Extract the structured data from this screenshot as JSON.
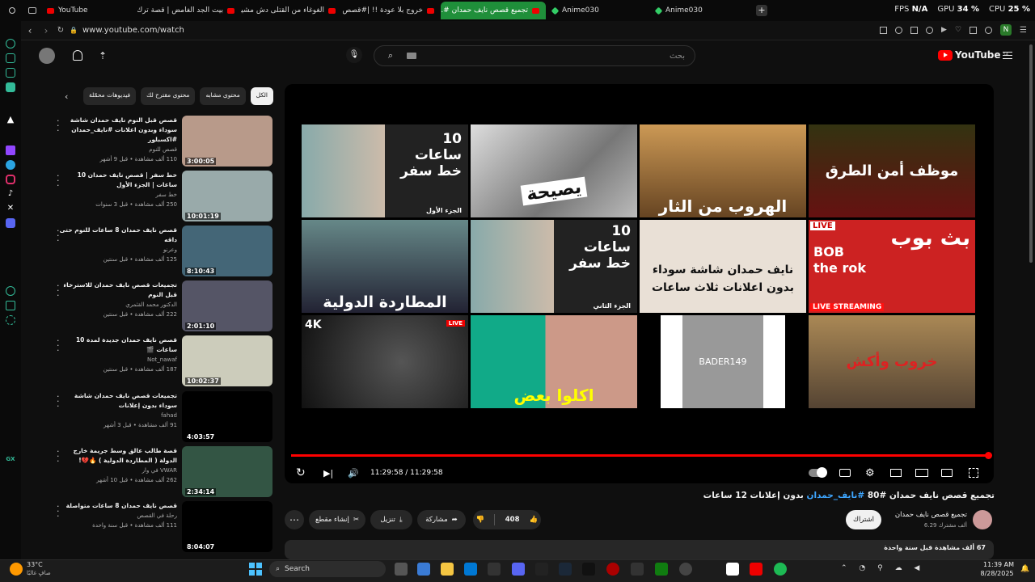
{
  "browser": {
    "tabs": [
      {
        "label": "YouTube",
        "icon": "youtube-icon"
      },
      {
        "label": "بيت الجد الغامض | قصة ترك...",
        "icon": "youtube-icon"
      },
      {
        "label": "الغوغاء من القتلى دش مشير",
        "icon": "youtube-icon"
      },
      {
        "label": "خروج بلا عودة !! |#قصص...",
        "icon": "youtube-icon"
      },
      {
        "label": "تجميع قصص نايف حمدان #...",
        "icon": "youtube-icon",
        "active": true
      },
      {
        "label": "Anime030",
        "icon": "gem-icon"
      },
      {
        "label": "Anime030",
        "icon": "gem-icon"
      }
    ],
    "new_tab": "+",
    "fps_label": "FPS",
    "fps_value": "N/A",
    "gpu_label": "GPU",
    "gpu_value": "34 %",
    "cpu_label": "CPU",
    "cpu_value": "25 %",
    "url": "www.youtube.com/watch",
    "profile_initial": "N"
  },
  "youtube": {
    "logo": "YouTube",
    "logo_region": "SA",
    "search_placeholder": "بحث"
  },
  "chips": [
    "الكل",
    "محتوى مشابه",
    "محتوى مقترح لك",
    "فيديوهات محمّلة"
  ],
  "related": [
    {
      "title": "قصص قبل النوم نايف حمدان شاشة سوداء وبدون اعلانات #نايف_حمدان #اكسبلور",
      "channel": "قصص للنوم",
      "meta": "110 ألف مشاهدة • قبل 9 أشهر",
      "duration": "3:00:05"
    },
    {
      "title": "خط سفر | قصص نايف حمدان 10 ساعات | الجزء الأول",
      "channel": "خط سفر",
      "meta": "250 ألف مشاهدة • قبل 3 سنوات",
      "duration": "10:01:19"
    },
    {
      "title": "قصص نايف حمدان 8 ساعات للنوم حتى داقه",
      "channel": "وعرنو",
      "meta": "125 ألف مشاهدة • قبل سنتين",
      "duration": "8:10:43"
    },
    {
      "title": "تجميعات قصص نايف حمدان للاسترخاء قبل النوم",
      "channel": "الدكتور محمد القثمري",
      "meta": "222 ألف مشاهدة • قبل سنتين",
      "duration": "2:01:10"
    },
    {
      "title": "قصص نايف حمدان جديدة لمدة 10 ساعات 🎬",
      "channel": "Not_nawaf",
      "meta": "187 ألف مشاهدة • قبل سنتين",
      "duration": "10:02:37"
    },
    {
      "title": "تجميعات قصص نايف حمدان شاشة سوداء بدون إعلانات",
      "channel": "fahad",
      "meta": "91 ألف مشاهدة • قبل 3 أشهر",
      "duration": "4:03:57"
    },
    {
      "title": "قصة طالب عالق وسط جريمة خارج الدولة ( المطاردة الدولية ) 🔥💔!",
      "channel": "VWAR في وار",
      "meta": "262 ألف مشاهدة • قبل 10 أشهر",
      "duration": "2:34:14"
    },
    {
      "title": "قصص نايف حمدان 8 ساعات متواصلة",
      "channel": "رحلة في القصص",
      "meta": "111 ألف مشاهدة • قبل سنة واحدة",
      "duration": "8:04:07"
    }
  ],
  "thumb_texts": {
    "t1": "10 ساعات خط سفر",
    "t1b": "الجزء الأول",
    "t2": "يصيحة",
    "t3": "الهروب من الثار",
    "t4": "موظف أمن الطرق",
    "t5": "المطاردة الدولية",
    "t6": "10 ساعات خط سفر",
    "t6b": "الجزء الثاني",
    "t7": "نايف حمدان شاشة سوداء بدون اعلانات ثلاث ساعات",
    "t8a": "بث بوب",
    "t8b": "BOB the rok",
    "t8c": "LIVE",
    "t8d": "LIVE STREAMING",
    "t9": "4K",
    "t9b": "LIVE",
    "t10": "اكلوا بعض",
    "t11": "BADER149",
    "t12": "خروب وأكش"
  },
  "player": {
    "time": "11:29:58 / 11:29:58",
    "progress": 1.0
  },
  "video": {
    "title_a": "تجميع قصص نايف حمدان #80 ",
    "title_tag": "#نايف_حمدان",
    "title_b": " بدون إعلانات 12 ساعات",
    "channel": "تجميع قصص نايف حمدان",
    "subs": "6.29 ألف مشترك",
    "subscribe": "اشتراك",
    "likes": "408",
    "share": "مشاركة",
    "download": "تنزيل",
    "clip": "إنشاء مقطع",
    "views": "67 ألف مشاهدة قبل سنة واحدة"
  },
  "taskbar": {
    "temp": "33°C",
    "weather": "صافٍ غالبًا",
    "search": "Search",
    "time": "11:39 AM",
    "date": "8/28/2025"
  }
}
